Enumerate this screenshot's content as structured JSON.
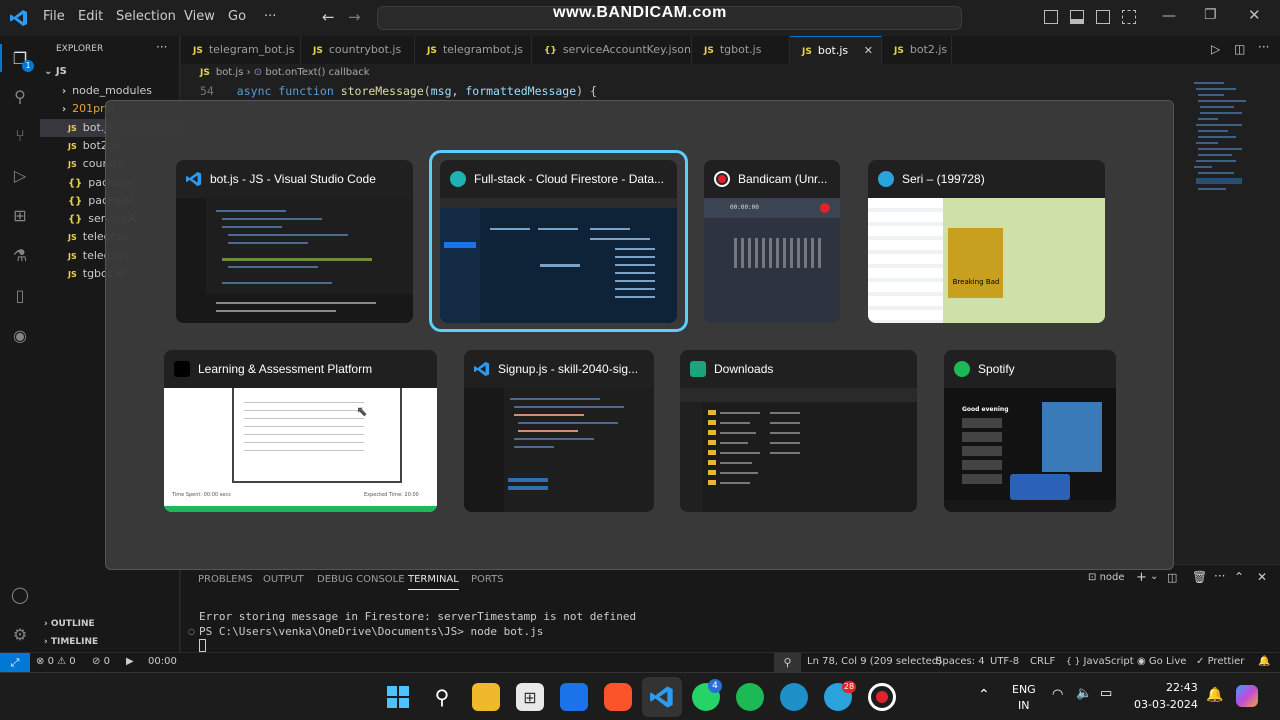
{
  "watermark": "www.BANDICAM.com",
  "menu": {
    "file": "File",
    "edit": "Edit",
    "selection": "Selection",
    "view": "View",
    "go": "Go",
    "more": "···"
  },
  "explorer": {
    "title": "EXPLORER",
    "root": "JS",
    "items": [
      "node_modules",
      "201proj",
      "bot.js",
      "bot2.js",
      "country",
      "package",
      "package",
      "serviceA",
      "telegran",
      "telegran",
      "tgbot.js"
    ],
    "outline": "OUTLINE",
    "timeline": "TIMELINE"
  },
  "tabs": [
    "telegram_bot.js",
    "countrybot.js",
    "telegrambot.js",
    "serviceAccountKey.json",
    "tgbot.js",
    "bot.js",
    "bot2.js"
  ],
  "breadcrumb": {
    "file": "bot.js",
    "symbol": "bot.onText() callback"
  },
  "code": {
    "line_no": "54",
    "kw1": "async",
    "kw2": "function",
    "fn": "storeMessage",
    "p1": "msg",
    "p2": "formattedMessage"
  },
  "switcher": {
    "windows": [
      {
        "title": "bot.js - JS - Visual Studio Code",
        "icon": "vscode-icon"
      },
      {
        "title": "Full-stack - Cloud Firestore - Data...",
        "icon": "edge-icon"
      },
      {
        "title": "Bandicam (Unr...",
        "icon": "bandicam-icon"
      },
      {
        "title": "Seri – (199728)",
        "icon": "telegram-icon"
      },
      {
        "title": "Learning & Assessment Platform",
        "icon": "browser-icon"
      },
      {
        "title": "Signup.js - skill-2040-sig...",
        "icon": "vscode-icon"
      },
      {
        "title": "Downloads",
        "icon": "folder-icon"
      },
      {
        "title": "Spotify",
        "icon": "spotify-icon"
      }
    ],
    "thumb_text": {
      "bandicam_timer": "00:00:00",
      "bb_caption": "Breaking Bad",
      "time_spent": "Time Spent: 00:00 secs",
      "expected_time": "Expected Time: 20:00",
      "spotify_greeting": "Good evening"
    }
  },
  "panel": {
    "tabs": [
      "PROBLEMS",
      "OUTPUT",
      "DEBUG CONSOLE",
      "TERMINAL",
      "PORTS"
    ],
    "active_tab": "TERMINAL",
    "shell": "node",
    "lines": [
      "Error storing message in Firestore:  serverTimestamp is not defined",
      "PS C:\\Users\\venka\\OneDrive\\Documents\\JS> node bot.js"
    ]
  },
  "status": {
    "errors": "0",
    "warnings": "0",
    "ports": "0",
    "time": "00:00",
    "position": "Ln 78, Col 9 (209 selected)",
    "spaces": "Spaces: 4",
    "encoding": "UTF-8",
    "eol": "CRLF",
    "language": "JavaScript",
    "golive": "Go Live",
    "prettier": "Prettier"
  },
  "taskbar": {
    "whatsapp_badge": "4",
    "telegram_badge": "28",
    "lang_top": "ENG",
    "lang_bottom": "IN",
    "time": "22:43",
    "date": "03-03-2024"
  },
  "colors": {
    "accent": "#0078d4",
    "selected_border": "#60cdff",
    "js_yellow": "#e8d44d",
    "keyword": "#569cd6",
    "function": "#dcdcaa",
    "param": "#9cdcfe"
  }
}
